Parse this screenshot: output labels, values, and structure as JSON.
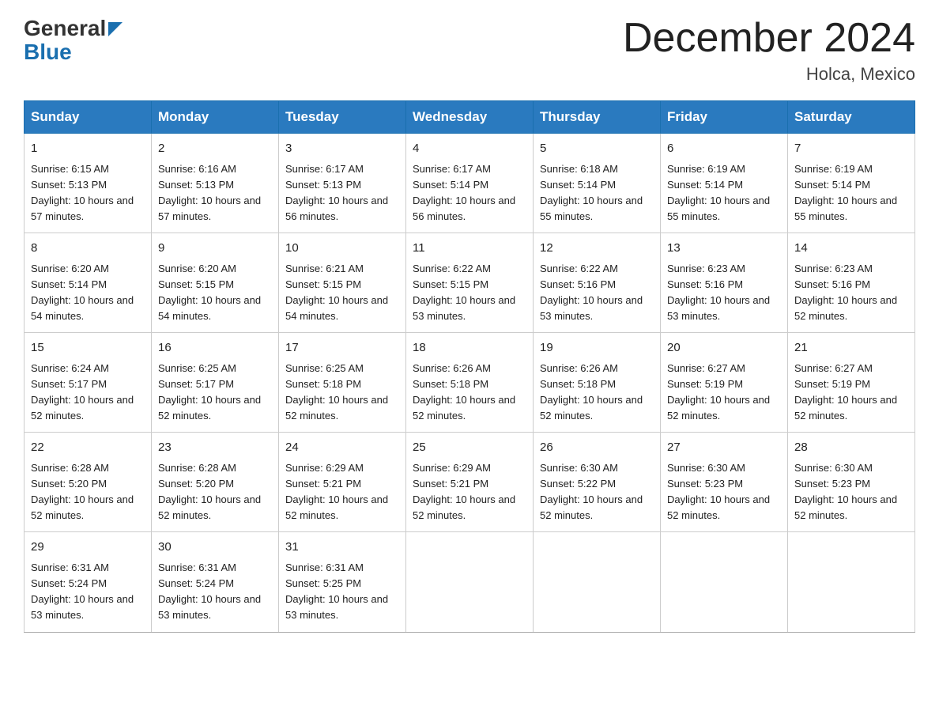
{
  "header": {
    "logo_general": "General",
    "logo_blue": "Blue",
    "month_title": "December 2024",
    "location": "Holca, Mexico"
  },
  "calendar": {
    "days_of_week": [
      "Sunday",
      "Monday",
      "Tuesday",
      "Wednesday",
      "Thursday",
      "Friday",
      "Saturday"
    ],
    "weeks": [
      [
        {
          "day": "1",
          "sunrise": "6:15 AM",
          "sunset": "5:13 PM",
          "daylight": "10 hours and 57 minutes."
        },
        {
          "day": "2",
          "sunrise": "6:16 AM",
          "sunset": "5:13 PM",
          "daylight": "10 hours and 57 minutes."
        },
        {
          "day": "3",
          "sunrise": "6:17 AM",
          "sunset": "5:13 PM",
          "daylight": "10 hours and 56 minutes."
        },
        {
          "day": "4",
          "sunrise": "6:17 AM",
          "sunset": "5:14 PM",
          "daylight": "10 hours and 56 minutes."
        },
        {
          "day": "5",
          "sunrise": "6:18 AM",
          "sunset": "5:14 PM",
          "daylight": "10 hours and 55 minutes."
        },
        {
          "day": "6",
          "sunrise": "6:19 AM",
          "sunset": "5:14 PM",
          "daylight": "10 hours and 55 minutes."
        },
        {
          "day": "7",
          "sunrise": "6:19 AM",
          "sunset": "5:14 PM",
          "daylight": "10 hours and 55 minutes."
        }
      ],
      [
        {
          "day": "8",
          "sunrise": "6:20 AM",
          "sunset": "5:14 PM",
          "daylight": "10 hours and 54 minutes."
        },
        {
          "day": "9",
          "sunrise": "6:20 AM",
          "sunset": "5:15 PM",
          "daylight": "10 hours and 54 minutes."
        },
        {
          "day": "10",
          "sunrise": "6:21 AM",
          "sunset": "5:15 PM",
          "daylight": "10 hours and 54 minutes."
        },
        {
          "day": "11",
          "sunrise": "6:22 AM",
          "sunset": "5:15 PM",
          "daylight": "10 hours and 53 minutes."
        },
        {
          "day": "12",
          "sunrise": "6:22 AM",
          "sunset": "5:16 PM",
          "daylight": "10 hours and 53 minutes."
        },
        {
          "day": "13",
          "sunrise": "6:23 AM",
          "sunset": "5:16 PM",
          "daylight": "10 hours and 53 minutes."
        },
        {
          "day": "14",
          "sunrise": "6:23 AM",
          "sunset": "5:16 PM",
          "daylight": "10 hours and 52 minutes."
        }
      ],
      [
        {
          "day": "15",
          "sunrise": "6:24 AM",
          "sunset": "5:17 PM",
          "daylight": "10 hours and 52 minutes."
        },
        {
          "day": "16",
          "sunrise": "6:25 AM",
          "sunset": "5:17 PM",
          "daylight": "10 hours and 52 minutes."
        },
        {
          "day": "17",
          "sunrise": "6:25 AM",
          "sunset": "5:18 PM",
          "daylight": "10 hours and 52 minutes."
        },
        {
          "day": "18",
          "sunrise": "6:26 AM",
          "sunset": "5:18 PM",
          "daylight": "10 hours and 52 minutes."
        },
        {
          "day": "19",
          "sunrise": "6:26 AM",
          "sunset": "5:18 PM",
          "daylight": "10 hours and 52 minutes."
        },
        {
          "day": "20",
          "sunrise": "6:27 AM",
          "sunset": "5:19 PM",
          "daylight": "10 hours and 52 minutes."
        },
        {
          "day": "21",
          "sunrise": "6:27 AM",
          "sunset": "5:19 PM",
          "daylight": "10 hours and 52 minutes."
        }
      ],
      [
        {
          "day": "22",
          "sunrise": "6:28 AM",
          "sunset": "5:20 PM",
          "daylight": "10 hours and 52 minutes."
        },
        {
          "day": "23",
          "sunrise": "6:28 AM",
          "sunset": "5:20 PM",
          "daylight": "10 hours and 52 minutes."
        },
        {
          "day": "24",
          "sunrise": "6:29 AM",
          "sunset": "5:21 PM",
          "daylight": "10 hours and 52 minutes."
        },
        {
          "day": "25",
          "sunrise": "6:29 AM",
          "sunset": "5:21 PM",
          "daylight": "10 hours and 52 minutes."
        },
        {
          "day": "26",
          "sunrise": "6:30 AM",
          "sunset": "5:22 PM",
          "daylight": "10 hours and 52 minutes."
        },
        {
          "day": "27",
          "sunrise": "6:30 AM",
          "sunset": "5:23 PM",
          "daylight": "10 hours and 52 minutes."
        },
        {
          "day": "28",
          "sunrise": "6:30 AM",
          "sunset": "5:23 PM",
          "daylight": "10 hours and 52 minutes."
        }
      ],
      [
        {
          "day": "29",
          "sunrise": "6:31 AM",
          "sunset": "5:24 PM",
          "daylight": "10 hours and 53 minutes."
        },
        {
          "day": "30",
          "sunrise": "6:31 AM",
          "sunset": "5:24 PM",
          "daylight": "10 hours and 53 minutes."
        },
        {
          "day": "31",
          "sunrise": "6:31 AM",
          "sunset": "5:25 PM",
          "daylight": "10 hours and 53 minutes."
        },
        null,
        null,
        null,
        null
      ]
    ]
  }
}
